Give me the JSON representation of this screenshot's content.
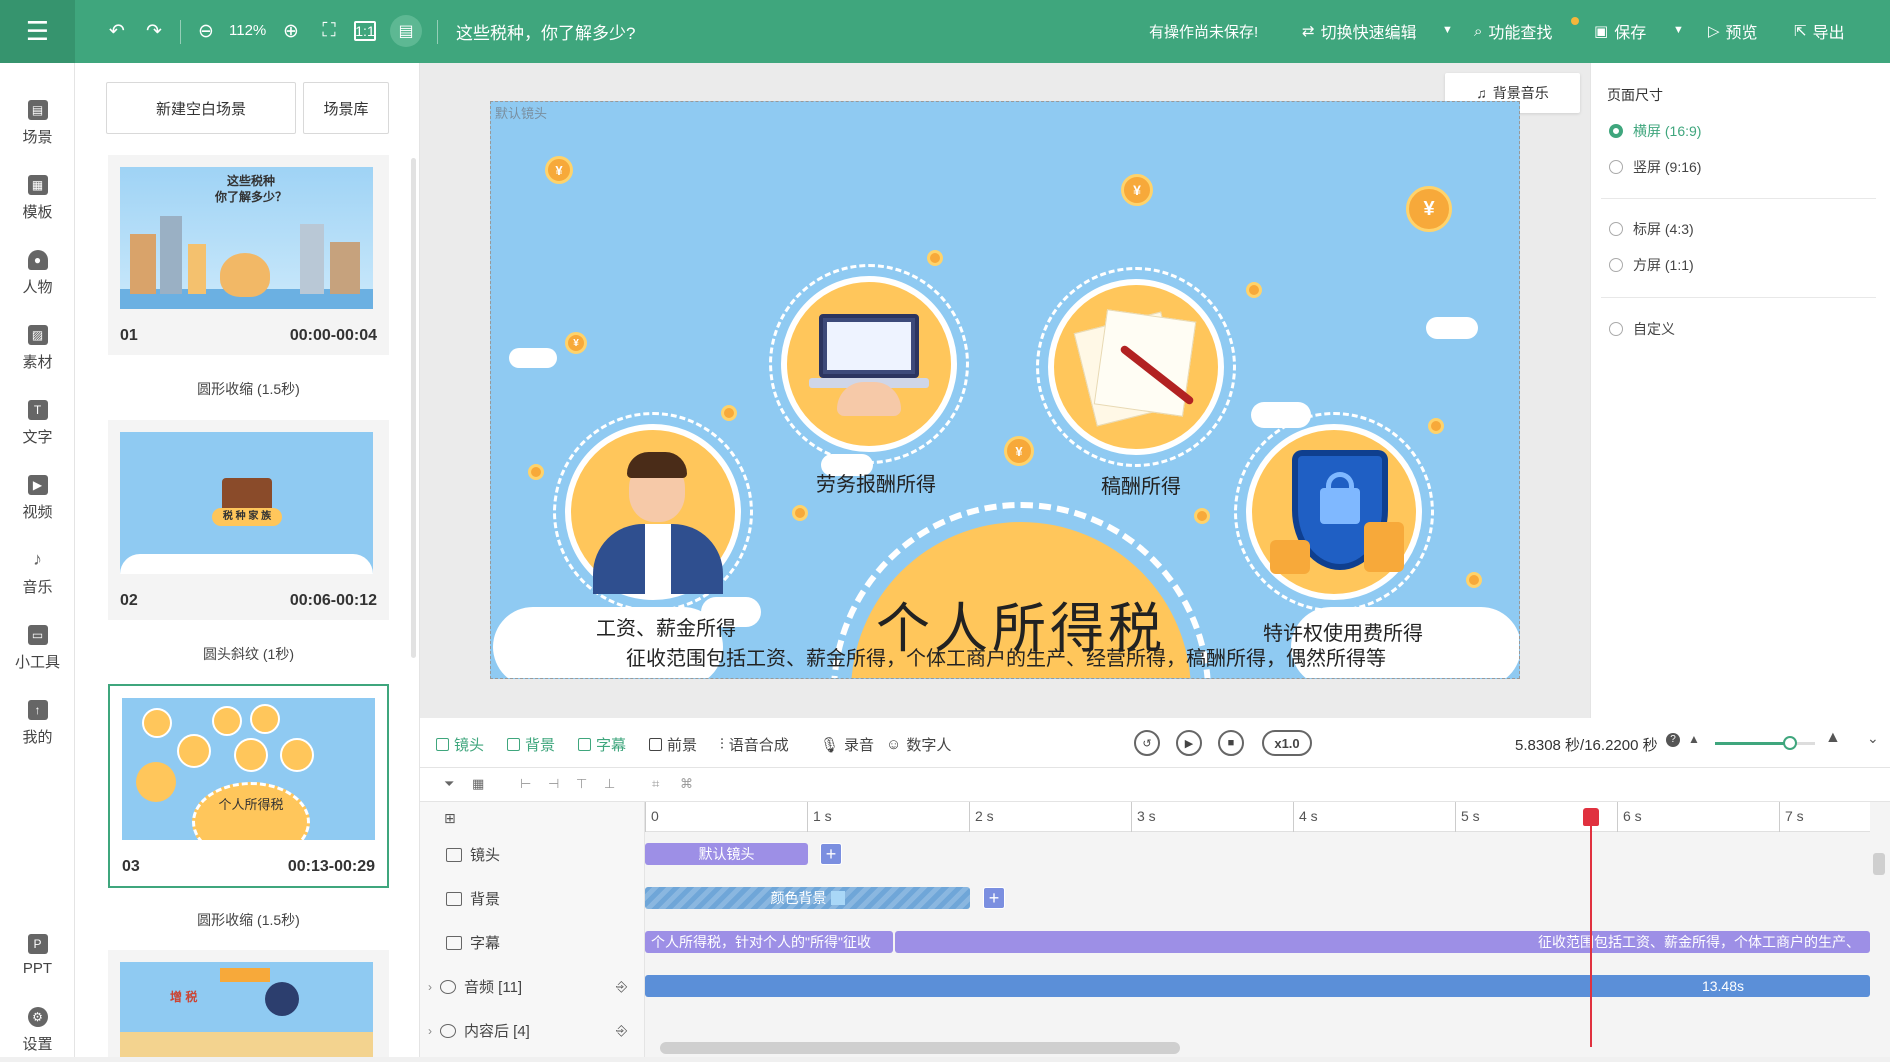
{
  "topbar": {
    "project_title": "这些税种，你了解多少?",
    "zoom": "112%",
    "unsaved_notice": "有操作尚未保存!",
    "switch_mode": "切换快速编辑",
    "feature_search": "功能查找",
    "save": "保存",
    "preview": "预览",
    "export": "导出"
  },
  "nav": {
    "items": [
      {
        "label": "场景",
        "icon": "scene-icon"
      },
      {
        "label": "模板",
        "icon": "template-icon"
      },
      {
        "label": "人物",
        "icon": "person-icon"
      },
      {
        "label": "素材",
        "icon": "material-icon"
      },
      {
        "label": "文字",
        "icon": "text-icon"
      },
      {
        "label": "视频",
        "icon": "video-icon"
      },
      {
        "label": "音乐",
        "icon": "music-icon"
      },
      {
        "label": "小工具",
        "icon": "toolbox-icon"
      },
      {
        "label": "我的",
        "icon": "upload-icon"
      },
      {
        "label": "PPT",
        "icon": "ppt-icon"
      },
      {
        "label": "设置",
        "icon": "gear-icon"
      }
    ]
  },
  "scenes": {
    "new_blank": "新建空白场景",
    "library": "场景库",
    "list": [
      {
        "index": "01",
        "time": "00:00-00:04",
        "transition": "圆形收缩 (1.5秒)",
        "thumb_title": "这些税种\n你了解多少？"
      },
      {
        "index": "02",
        "time": "00:06-00:12",
        "transition": "圆头斜纹 (1秒)",
        "thumb_title": "税 种 家 族"
      },
      {
        "index": "03",
        "time": "00:13-00:29",
        "transition": "圆形收缩 (1.5秒)",
        "thumb_title": "个人所得税"
      },
      {
        "index": "04",
        "time": "",
        "transition": "",
        "thumb_title": "增 税"
      }
    ]
  },
  "canvas": {
    "bgm": "背景音乐",
    "shot_label": "默认镜头",
    "labels": {
      "labor": "劳务报酬所得",
      "royalty": "稿酬所得",
      "wage": "工资、薪金所得",
      "franchise": "特许权使用费所得"
    },
    "headline": "个人所得税",
    "subtitle": "征收范围包括工资、薪金所得，个体工商户的生产、经营所得，稿酬所得，偶然所得等"
  },
  "right_panel": {
    "title": "页面尺寸",
    "options": [
      {
        "label": "横屏 (16:9)",
        "selected": true
      },
      {
        "label": "竖屏 (9:16)",
        "selected": false
      },
      {
        "label": "标屏 (4:3)",
        "selected": false
      },
      {
        "label": "方屏 (1:1)",
        "selected": false
      },
      {
        "label": "自定义",
        "selected": false
      }
    ]
  },
  "timeline": {
    "tabs": {
      "shot": "镜头",
      "background": "背景",
      "subtitle": "字幕",
      "foreground": "前景",
      "tts": "语音合成",
      "record": "录音",
      "digital_human": "数字人"
    },
    "speed": "x1.0",
    "time_readout": "5.8308 秒/16.2200 秒",
    "zoom_level": 0.75,
    "ruler": [
      "0",
      "1 s",
      "2 s",
      "3 s",
      "4 s",
      "5 s",
      "6 s",
      "7 s"
    ],
    "tracks": {
      "shot": "镜头",
      "background": "背景",
      "subtitle": "字幕",
      "audio": "音频 [11]",
      "after_content": "内容后 [4]"
    },
    "clips": {
      "shot": "默认镜头",
      "background": "颜色背景",
      "subtitle_1": "个人所得税，针对个人的\"所得\"征收",
      "subtitle_2": "征收范围包括工资、薪金所得，个体工商户的生产、",
      "audio": "13.48s"
    }
  },
  "colors": {
    "brand": "#3fa67d",
    "stage_bg": "#8fcaf2",
    "accent_orange": "#ffc65b",
    "clip_purple": "#9d8fe6",
    "clip_blue": "#5b8fd8",
    "playhead": "#e0313f"
  }
}
